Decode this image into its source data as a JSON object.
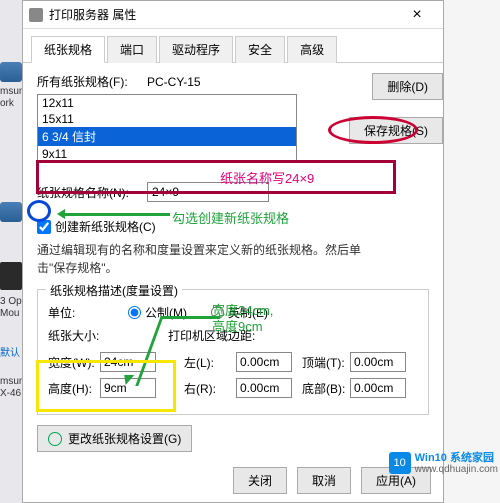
{
  "window": {
    "title": "打印服务器 属性",
    "close_glyph": "×"
  },
  "tabs": [
    "纸张规格",
    "端口",
    "驱动程序",
    "安全",
    "高级"
  ],
  "all_formats_label": "所有纸张规格(F):",
  "server_name": "PC-CY-15",
  "formats": [
    "12x11",
    "15x11",
    "6 3/4 信封",
    "9x11"
  ],
  "buttons": {
    "delete": "删除(D)",
    "save": "保存规格(S)",
    "change": "更改纸张规格设置(G)",
    "close": "关闭",
    "cancel": "取消",
    "apply": "应用(A)"
  },
  "name_label": "纸张规格名称(N):",
  "name_value": "24×9",
  "checkbox_label": "创建新纸张规格(C)",
  "desc_line1": "通过编辑现有的名称和度量设置来定义新的纸张规格。然后单",
  "desc_line2": "击\"保存规格\"。",
  "group_title": "纸张规格描述(度量设置)",
  "unit_label": "单位:",
  "radio_metric": "公制(M)",
  "radio_english": "英制(E)",
  "size_header": "纸张大小:",
  "margin_header": "打印机区域边距:",
  "width_label": "宽度(W):",
  "height_label": "高度(H):",
  "left_label": "左(L):",
  "right_label": "右(R):",
  "top_label": "顶端(T):",
  "bottom_label": "底部(B):",
  "width_value": "24cm",
  "height_value": "9cm",
  "margin_left": "0.00cm",
  "margin_right": "0.00cm",
  "margin_top": "0.00cm",
  "margin_bottom": "0.00cm",
  "annotations": {
    "name_hint": "纸张名称写24×9",
    "checkbox_hint": "勾选创建新纸张规格",
    "size_hint1": "宽度24cm,",
    "size_hint2": "高度9cm"
  },
  "left_labels": {
    "l1": "msun",
    "l2": "ork",
    "l3": "3 Op",
    "l4": "Mou",
    "l5": "默认",
    "l6": "msun",
    "l7": "X-46"
  },
  "watermark": {
    "brand_num": "10",
    "brand": "Win10 系统家园",
    "url": "www.qdhuajin.com"
  }
}
